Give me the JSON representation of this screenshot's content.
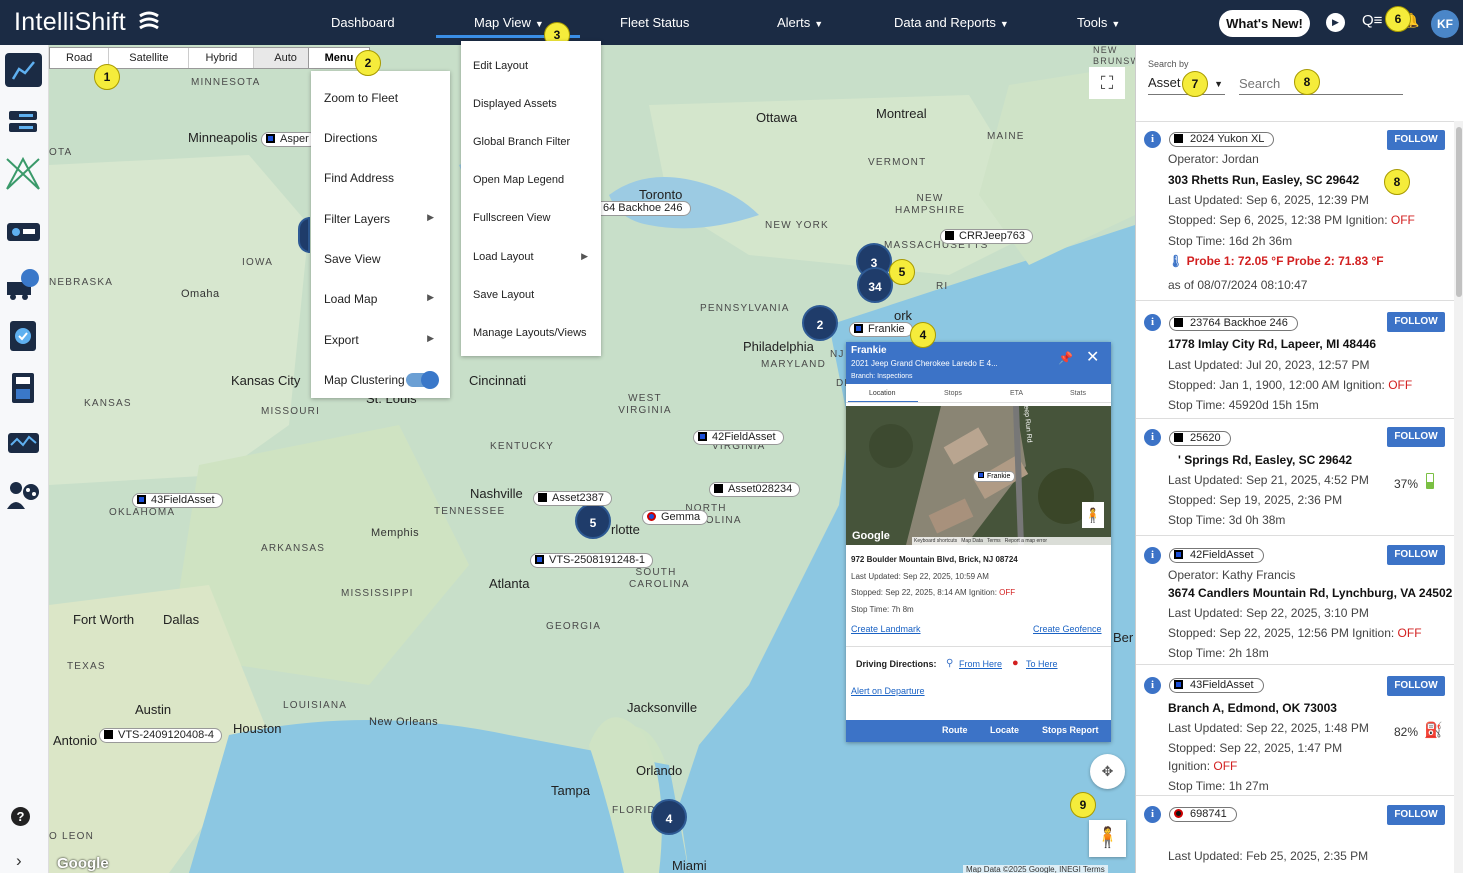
{
  "app": {
    "logo": "IntelliShift"
  },
  "nav": {
    "dashboard": "Dashboard",
    "map_view": "Map View",
    "fleet_status": "Fleet Status",
    "alerts": "Alerts",
    "data_reports": "Data and Reports",
    "tools": "Tools",
    "whats_new": "What's New!",
    "user_initials": "KF"
  },
  "map_type": {
    "road": "Road",
    "satellite": "Satellite",
    "hybrid": "Hybrid",
    "auto": "Auto"
  },
  "menu": {
    "button_label": "Menu",
    "items": [
      "Zoom to Fleet",
      "Directions",
      "Find Address",
      "Filter Layers",
      "Save View",
      "Load Map",
      "Export",
      "Map Clustering"
    ]
  },
  "map_view_menu": {
    "items": [
      "Edit Layout",
      "Displayed Assets",
      "Global Branch Filter",
      "Open Map Legend",
      "Fullscreen View",
      "Load Layout",
      "Save Layout",
      "Manage Layouts/Views"
    ]
  },
  "markers": [
    "1",
    "2",
    "3",
    "4",
    "5",
    "6",
    "7",
    "8",
    "8",
    "9"
  ],
  "map_labels": {
    "minnesota": "MINNESOTA",
    "minneapolis": "Minneapolis",
    "iowa": "IOWA",
    "nebraska": "NEBRASKA",
    "omaha": "Omaha",
    "kansas_city": "Kansas City",
    "kansas": "KANSAS",
    "missouri": "MISSOURI",
    "st_louis": "St. Louis",
    "oklahoma": "OKLAHOMA",
    "arkansas": "ARKANSAS",
    "memphis": "Memphis",
    "mississippi": "MISSISSIPPI",
    "fort_worth": "Fort Worth",
    "dallas": "Dallas",
    "texas": "TEXAS",
    "louisiana": "LOUISIANA",
    "new_orleans": "New Orleans",
    "austin": "Austin",
    "houston": "Houston",
    "antonio": "Antonio",
    "leon": "O LEON",
    "tennessee": "TENNESSEE",
    "nashville": "Nashville",
    "kentucky": "KENTUCKY",
    "cincinnati": "Cincinnati",
    "west_virginia": "WEST VIRGINIA",
    "virginia": "VIRGINIA",
    "atlanta": "Atlanta",
    "georgia": "GEORGIA",
    "south_carolina": "SOUTH CAROLINA",
    "north_carolina": "NORTH CAROLINA",
    "charlotte": "rlotte",
    "jacksonville": "Jacksonville",
    "orlando": "Orlando",
    "tampa": "Tampa",
    "florida": "FLORIDA",
    "miami": "Miami",
    "ottawa": "Ottawa",
    "montreal": "Montreal",
    "toronto": "Toronto",
    "maine": "MAINE",
    "vermont": "VERMONT",
    "new_hampshire": "NEW HAMPSHIRE",
    "new_york": "NEW YORK",
    "massachusetts": "MASSACHUSETTS",
    "pennsylvania": "PENNSYLVANIA",
    "philadelphia": "Philadelphia",
    "maryland": "MARYLAND",
    "new_brunswick": "NEW BRUNSWICK",
    "ri": "RI",
    "nj": "NJ",
    "de": "DE",
    "ork": "ork",
    "ota": "OTA",
    "ber": "Ber"
  },
  "clusters": [
    "3",
    "34",
    "2",
    "5",
    "4"
  ],
  "map_assets": [
    "Asper",
    "64 Backhoe 246",
    "CRRJeep763",
    "Frankie",
    "42FieldAsset",
    "43FieldAsset",
    "Asset2387",
    "Asset028234",
    "Gemma",
    "VTS-2508191248-1",
    "VTS-2409120408-4"
  ],
  "popup": {
    "name": "Frankie",
    "vehicle": "2021 Jeep Grand Cherokee Laredo E 4...",
    "branch": "Branch: Inspections",
    "tabs": [
      "Location",
      "Stops",
      "ETA",
      "Stats"
    ],
    "image_asset_label": "Frankie",
    "image_road": "Deep Run Rd",
    "image_footer": "Keyboard shortcuts   Map Data   Terms   Report a map error",
    "address": "972 Boulder Mountain Blvd, Brick, NJ 08724",
    "last_updated_label": "Last Updated:",
    "last_updated": "Sep 22, 2025, 10:59 AM",
    "stopped_label": "Stopped:",
    "stopped": "Sep 22, 2025, 8:14 AM",
    "ignition_label": "Ignition:",
    "ignition": "OFF",
    "stop_time_label": "Stop Time:",
    "stop_time": "7h 8m",
    "create_landmark": "Create Landmark",
    "create_geofence": "Create Geofence",
    "driving_directions": "Driving Directions:",
    "from_here": "From Here",
    "to_here": "To Here",
    "alert_departure": "Alert on Departure",
    "route": "Route",
    "locate": "Locate",
    "stops_report": "Stops Report"
  },
  "map_footer": "Map Data ©2025 Google, INEGI   Terms",
  "google_logo": "Google",
  "search": {
    "by_label": "Search by",
    "type": "Asset",
    "placeholder": "Search"
  },
  "follow_label": "FOLLOW",
  "labels": {
    "operator": "Operator:",
    "last_updated": "Last Updated:",
    "stopped": "Stopped:",
    "ignition": "Ignition:",
    "stop_time": "Stop Time:"
  },
  "assets": [
    {
      "name": "2024 Yukon XL",
      "operator": "Jordan",
      "address": "303 Rhetts Run, Easley, SC 29642",
      "last_updated": "Sep 6, 2025, 12:39 PM",
      "stopped": "Sep 6, 2025, 12:38 PM",
      "ignition": "OFF",
      "stop_time": "16d 2h 36m",
      "probe": "Probe 1: 72.05 °F Probe 2: 71.83 °F",
      "as_of": "as of 08/07/2024 08:10:47"
    },
    {
      "name": "23764 Backhoe 246",
      "address": "1778 Imlay City Rd, Lapeer, MI 48446",
      "last_updated": "Jul 20, 2023, 12:57 PM",
      "stopped": "Jan 1, 1900, 12:00 AM",
      "ignition": "OFF",
      "stop_time": "45920d 15h 15m"
    },
    {
      "name": "25620",
      "address": "' Springs Rd, Easley, SC 29642",
      "last_updated": "Sep 21, 2025, 4:52 PM",
      "stopped": "Sep 19, 2025, 2:36 PM",
      "stop_time": "3d 0h 38m",
      "battery": "37%"
    },
    {
      "name": "42FieldAsset",
      "operator": "Kathy Francis",
      "address": "3674 Candlers Mountain Rd, Lynchburg, VA 24502",
      "last_updated": "Sep 22, 2025, 3:10 PM",
      "stopped": "Sep 22, 2025, 12:56 PM",
      "ignition": "OFF",
      "stop_time": "2h 18m"
    },
    {
      "name": "43FieldAsset",
      "address": "Branch A, Edmond, OK 73003",
      "last_updated": "Sep 22, 2025, 1:48 PM",
      "stopped": "Sep 22, 2025, 1:47 PM",
      "ignition": "OFF",
      "stop_time": "1h 27m",
      "fuel": "82%"
    },
    {
      "name": "698741",
      "last_updated": "Feb 25, 2025, 2:35 PM"
    }
  ]
}
